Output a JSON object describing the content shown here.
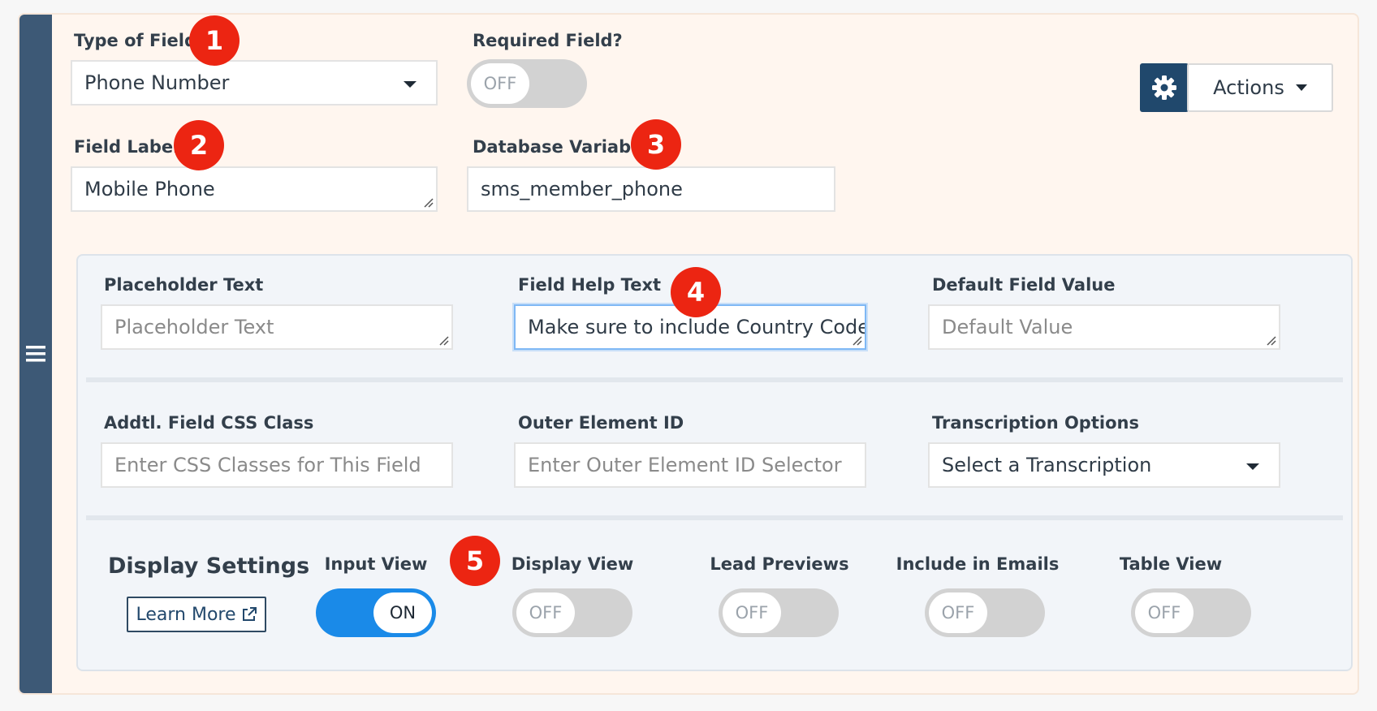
{
  "top": {
    "type_of_field": {
      "label": "Type of Field",
      "value": "Phone Number"
    },
    "required_field": {
      "label": "Required Field?",
      "toggle": "OFF"
    },
    "actions_label": "Actions",
    "field_label": {
      "label": "Field Label",
      "value": "Mobile Phone"
    },
    "database_variable": {
      "label": "Database Variable",
      "value": "sms_member_phone"
    }
  },
  "advanced": {
    "placeholder_text": {
      "label": "Placeholder Text",
      "placeholder": "Placeholder Text"
    },
    "field_help_text": {
      "label": "Field Help Text",
      "value": "Make sure to include Country Code"
    },
    "default_field_value": {
      "label": "Default Field Value",
      "placeholder": "Default Value"
    },
    "css_class": {
      "label": "Addtl. Field CSS Class",
      "placeholder": "Enter CSS Classes for This Field"
    },
    "outer_element_id": {
      "label": "Outer Element ID",
      "placeholder": "Enter Outer Element ID Selector"
    },
    "transcription": {
      "label": "Transcription Options",
      "value": "Select a Transcription"
    }
  },
  "display_settings": {
    "title": "Display Settings",
    "learn_more": "Learn More",
    "toggles": [
      {
        "label": "Input View",
        "state": "ON"
      },
      {
        "label": "Display View",
        "state": "OFF"
      },
      {
        "label": "Lead Previews",
        "state": "OFF"
      },
      {
        "label": "Include in Emails",
        "state": "OFF"
      },
      {
        "label": "Table View",
        "state": "OFF"
      }
    ]
  },
  "badges": [
    "1",
    "2",
    "3",
    "4",
    "5"
  ],
  "colors": {
    "sidebar": "#3d5976",
    "badge": "#ec2512",
    "toggle_on": "#1a8ae8",
    "gear_button": "#20486c"
  }
}
